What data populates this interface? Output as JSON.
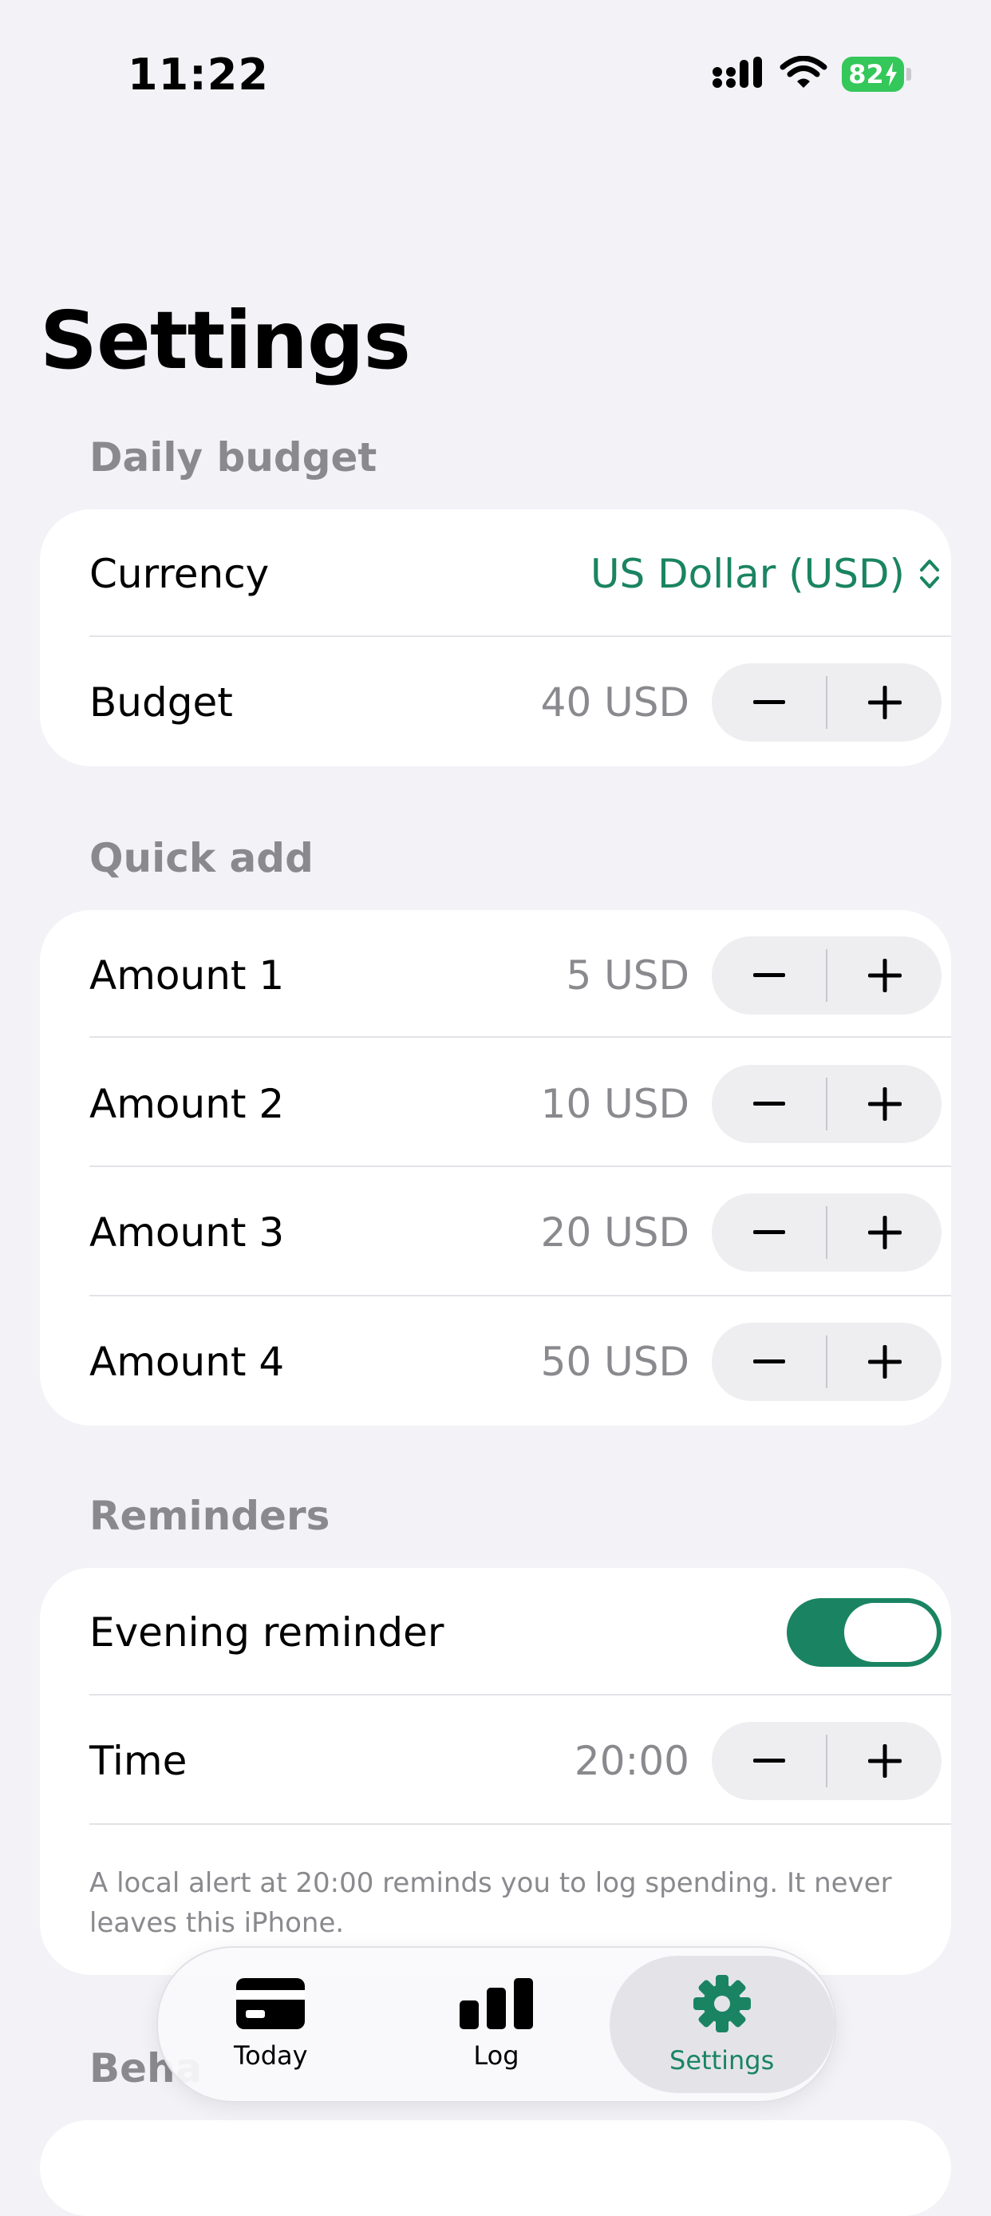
{
  "status_bar": {
    "time": "11:22",
    "battery": "82",
    "icons": [
      "cellular-signal-icon",
      "wifi-icon",
      "battery-charging-icon"
    ]
  },
  "title": "Settings",
  "sections": {
    "daily_budget": {
      "header": "Daily budget",
      "currency_label": "Currency",
      "currency_value": "US Dollar (USD)",
      "budget_label": "Budget",
      "budget_value": "40 USD"
    },
    "quick_add": {
      "header": "Quick add",
      "items": [
        {
          "label": "Amount 1",
          "value": "5 USD"
        },
        {
          "label": "Amount 2",
          "value": "10 USD"
        },
        {
          "label": "Amount 3",
          "value": "20 USD"
        },
        {
          "label": "Amount 4",
          "value": "50 USD"
        }
      ]
    },
    "reminders": {
      "header": "Reminders",
      "evening_label": "Evening reminder",
      "evening_enabled": true,
      "time_label": "Time",
      "time_value": "20:00",
      "footnote": "A local alert at 20:00 reminds you to log spending. It never leaves this iPhone."
    },
    "behavior": {
      "header": "Beha"
    }
  },
  "tabs": [
    {
      "label": "Today",
      "icon": "card-icon",
      "active": false
    },
    {
      "label": "Log",
      "icon": "bar-chart-icon",
      "active": false
    },
    {
      "label": "Settings",
      "icon": "gear-icon",
      "active": true
    }
  ],
  "colors": {
    "accent": "#1A8462",
    "background": "#F2F2F7",
    "secondary_text": "#8A8A8E",
    "battery": "#34C759"
  }
}
